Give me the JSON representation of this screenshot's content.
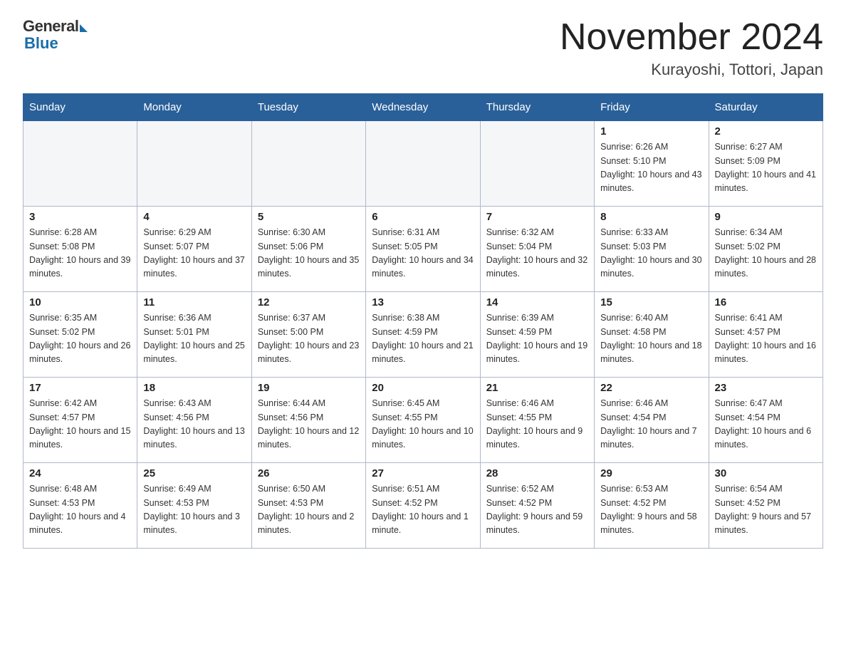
{
  "header": {
    "logo_general": "General",
    "logo_blue": "Blue",
    "month_title": "November 2024",
    "location": "Kurayoshi, Tottori, Japan"
  },
  "days_of_week": [
    "Sunday",
    "Monday",
    "Tuesday",
    "Wednesday",
    "Thursday",
    "Friday",
    "Saturday"
  ],
  "weeks": [
    [
      {
        "day": "",
        "info": ""
      },
      {
        "day": "",
        "info": ""
      },
      {
        "day": "",
        "info": ""
      },
      {
        "day": "",
        "info": ""
      },
      {
        "day": "",
        "info": ""
      },
      {
        "day": "1",
        "info": "Sunrise: 6:26 AM\nSunset: 5:10 PM\nDaylight: 10 hours and 43 minutes."
      },
      {
        "day": "2",
        "info": "Sunrise: 6:27 AM\nSunset: 5:09 PM\nDaylight: 10 hours and 41 minutes."
      }
    ],
    [
      {
        "day": "3",
        "info": "Sunrise: 6:28 AM\nSunset: 5:08 PM\nDaylight: 10 hours and 39 minutes."
      },
      {
        "day": "4",
        "info": "Sunrise: 6:29 AM\nSunset: 5:07 PM\nDaylight: 10 hours and 37 minutes."
      },
      {
        "day": "5",
        "info": "Sunrise: 6:30 AM\nSunset: 5:06 PM\nDaylight: 10 hours and 35 minutes."
      },
      {
        "day": "6",
        "info": "Sunrise: 6:31 AM\nSunset: 5:05 PM\nDaylight: 10 hours and 34 minutes."
      },
      {
        "day": "7",
        "info": "Sunrise: 6:32 AM\nSunset: 5:04 PM\nDaylight: 10 hours and 32 minutes."
      },
      {
        "day": "8",
        "info": "Sunrise: 6:33 AM\nSunset: 5:03 PM\nDaylight: 10 hours and 30 minutes."
      },
      {
        "day": "9",
        "info": "Sunrise: 6:34 AM\nSunset: 5:02 PM\nDaylight: 10 hours and 28 minutes."
      }
    ],
    [
      {
        "day": "10",
        "info": "Sunrise: 6:35 AM\nSunset: 5:02 PM\nDaylight: 10 hours and 26 minutes."
      },
      {
        "day": "11",
        "info": "Sunrise: 6:36 AM\nSunset: 5:01 PM\nDaylight: 10 hours and 25 minutes."
      },
      {
        "day": "12",
        "info": "Sunrise: 6:37 AM\nSunset: 5:00 PM\nDaylight: 10 hours and 23 minutes."
      },
      {
        "day": "13",
        "info": "Sunrise: 6:38 AM\nSunset: 4:59 PM\nDaylight: 10 hours and 21 minutes."
      },
      {
        "day": "14",
        "info": "Sunrise: 6:39 AM\nSunset: 4:59 PM\nDaylight: 10 hours and 19 minutes."
      },
      {
        "day": "15",
        "info": "Sunrise: 6:40 AM\nSunset: 4:58 PM\nDaylight: 10 hours and 18 minutes."
      },
      {
        "day": "16",
        "info": "Sunrise: 6:41 AM\nSunset: 4:57 PM\nDaylight: 10 hours and 16 minutes."
      }
    ],
    [
      {
        "day": "17",
        "info": "Sunrise: 6:42 AM\nSunset: 4:57 PM\nDaylight: 10 hours and 15 minutes."
      },
      {
        "day": "18",
        "info": "Sunrise: 6:43 AM\nSunset: 4:56 PM\nDaylight: 10 hours and 13 minutes."
      },
      {
        "day": "19",
        "info": "Sunrise: 6:44 AM\nSunset: 4:56 PM\nDaylight: 10 hours and 12 minutes."
      },
      {
        "day": "20",
        "info": "Sunrise: 6:45 AM\nSunset: 4:55 PM\nDaylight: 10 hours and 10 minutes."
      },
      {
        "day": "21",
        "info": "Sunrise: 6:46 AM\nSunset: 4:55 PM\nDaylight: 10 hours and 9 minutes."
      },
      {
        "day": "22",
        "info": "Sunrise: 6:46 AM\nSunset: 4:54 PM\nDaylight: 10 hours and 7 minutes."
      },
      {
        "day": "23",
        "info": "Sunrise: 6:47 AM\nSunset: 4:54 PM\nDaylight: 10 hours and 6 minutes."
      }
    ],
    [
      {
        "day": "24",
        "info": "Sunrise: 6:48 AM\nSunset: 4:53 PM\nDaylight: 10 hours and 4 minutes."
      },
      {
        "day": "25",
        "info": "Sunrise: 6:49 AM\nSunset: 4:53 PM\nDaylight: 10 hours and 3 minutes."
      },
      {
        "day": "26",
        "info": "Sunrise: 6:50 AM\nSunset: 4:53 PM\nDaylight: 10 hours and 2 minutes."
      },
      {
        "day": "27",
        "info": "Sunrise: 6:51 AM\nSunset: 4:52 PM\nDaylight: 10 hours and 1 minute."
      },
      {
        "day": "28",
        "info": "Sunrise: 6:52 AM\nSunset: 4:52 PM\nDaylight: 9 hours and 59 minutes."
      },
      {
        "day": "29",
        "info": "Sunrise: 6:53 AM\nSunset: 4:52 PM\nDaylight: 9 hours and 58 minutes."
      },
      {
        "day": "30",
        "info": "Sunrise: 6:54 AM\nSunset: 4:52 PM\nDaylight: 9 hours and 57 minutes."
      }
    ]
  ]
}
